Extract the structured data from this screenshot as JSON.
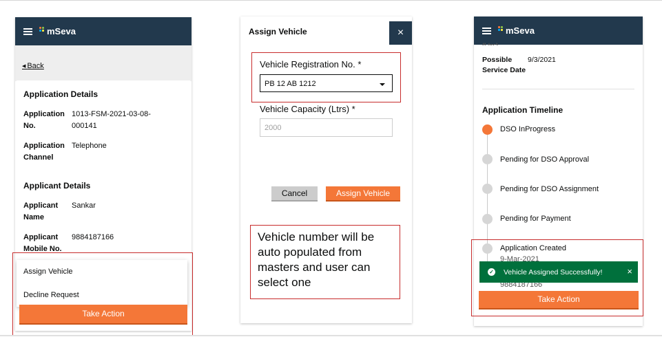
{
  "brand": {
    "name": "mSeva",
    "header_color": "#22394d",
    "accent": "#f47738",
    "success": "#00703c",
    "highlight": "#c72b2b"
  },
  "screen1": {
    "back_label": "Back",
    "application_details_title": "Application Details",
    "application_no_label": "Application No.",
    "application_no_value": "1013-FSM-2021-03-08-000141",
    "application_channel_label": "Application Channel",
    "application_channel_value": "Telephone",
    "applicant_details_title": "Applicant Details",
    "applicant_name_label": "Applicant Name",
    "applicant_name_value": "Sankar",
    "applicant_mobile_label": "Applicant Mobile No.",
    "applicant_mobile_value": "9884187166",
    "menu_items": [
      "Assign Vehicle",
      "Decline Request"
    ],
    "take_action_label": "Take Action"
  },
  "screen2": {
    "title": "Assign Vehicle",
    "close_icon": "×",
    "vehicle_reg_label": "Vehicle Registration No. *",
    "vehicle_reg_value": "PB 12 AB 1212",
    "vehicle_capacity_label": "Vehicle Capacity (Ltrs) *",
    "vehicle_capacity_placeholder": "2000",
    "cancel_label": "Cancel",
    "assign_label": "Assign Vehicle",
    "note": "Vehicle number will be auto populated from masters and user can select one"
  },
  "screen3": {
    "truncated_top": "(Ltrs)",
    "possible_service_date_label": "Possible Service Date",
    "possible_service_date_value": "9/3/2021",
    "timeline_title": "Application Timeline",
    "timeline": [
      {
        "label": "DSO InProgress",
        "active": true
      },
      {
        "label": "Pending for DSO Approval",
        "active": false
      },
      {
        "label": "Pending for DSO Assignment",
        "active": false
      },
      {
        "label": "Pending for Payment",
        "active": false
      },
      {
        "label": "Application Created",
        "active": false
      }
    ],
    "created_date": "9-Mar-2021",
    "created_phone": "9884187166",
    "toast_message": "Vehicle Assigned Successfully!",
    "toast_close": "×",
    "take_action_label": "Take Action"
  }
}
